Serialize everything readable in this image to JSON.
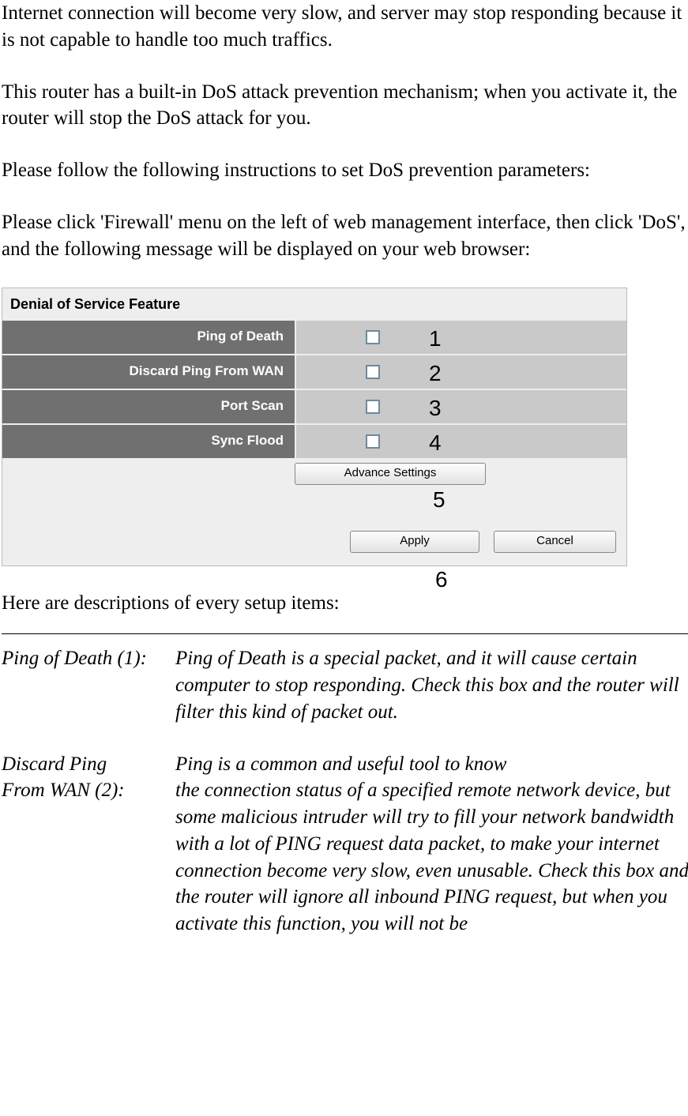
{
  "intro": {
    "p1": "Internet connection will become very slow, and server may stop responding because it is not capable to handle too much traffics.",
    "p2": "This router has a built-in DoS attack prevention mechanism; when you activate it, the router will stop the DoS attack for you.",
    "p3": "Please follow the following instructions to set DoS prevention parameters:",
    "p4": "Please click 'Firewall' menu on the left of web management interface, then click 'DoS', and the following message will be displayed on your web browser:"
  },
  "panel": {
    "title": "Denial of Service Feature",
    "rows": [
      {
        "label": "Ping of Death",
        "callout": "1"
      },
      {
        "label": "Discard Ping From WAN",
        "callout": "2"
      },
      {
        "label": "Port Scan",
        "callout": "3"
      },
      {
        "label": "Sync Flood",
        "callout": "4"
      }
    ],
    "advance_btn": "Advance Settings",
    "apply_btn": "Apply",
    "cancel_btn": "Cancel",
    "callout5": "5",
    "callout6": "6"
  },
  "desc_intro": "Here are descriptions of every setup items:",
  "descriptions": [
    {
      "label": "Ping of Death (1):",
      "text": "Ping of Death is a special packet, and it will cause certain computer to stop responding. Check this box and the router will filter this kind of packet out."
    },
    {
      "label_line1": "Discard Ping",
      "label_line2": "From WAN (2):",
      "text_line1": "Ping is a common and useful tool to know",
      "text_rest": "the connection status of a specified remote network device, but some malicious intruder will try to fill your network bandwidth with a lot of PING request data packet, to make your internet connection become very slow, even unusable. Check this box and the router will ignore all inbound PING request, but when you activate this function, you will not be"
    }
  ]
}
